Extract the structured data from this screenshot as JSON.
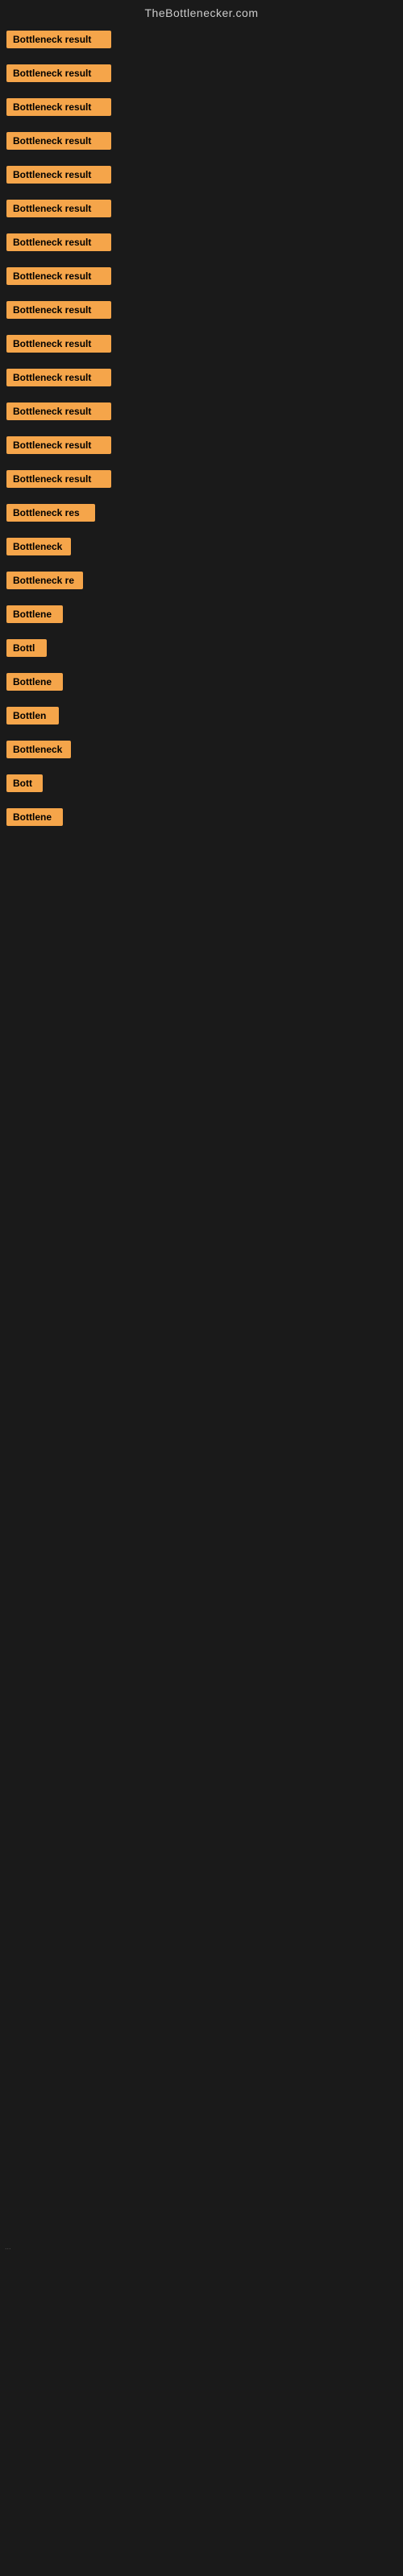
{
  "header": {
    "title": "TheBottlenecker.com"
  },
  "items": [
    {
      "label": "Bottleneck result",
      "width": 130
    },
    {
      "label": "Bottleneck result",
      "width": 130
    },
    {
      "label": "Bottleneck result",
      "width": 130
    },
    {
      "label": "Bottleneck result",
      "width": 130
    },
    {
      "label": "Bottleneck result",
      "width": 130
    },
    {
      "label": "Bottleneck result",
      "width": 130
    },
    {
      "label": "Bottleneck result",
      "width": 130
    },
    {
      "label": "Bottleneck result",
      "width": 130
    },
    {
      "label": "Bottleneck result",
      "width": 130
    },
    {
      "label": "Bottleneck result",
      "width": 130
    },
    {
      "label": "Bottleneck result",
      "width": 130
    },
    {
      "label": "Bottleneck result",
      "width": 130
    },
    {
      "label": "Bottleneck result",
      "width": 130
    },
    {
      "label": "Bottleneck result",
      "width": 130
    },
    {
      "label": "Bottleneck res",
      "width": 110
    },
    {
      "label": "Bottleneck",
      "width": 80
    },
    {
      "label": "Bottleneck re",
      "width": 95
    },
    {
      "label": "Bottlene",
      "width": 70
    },
    {
      "label": "Bottl",
      "width": 50
    },
    {
      "label": "Bottlene",
      "width": 70
    },
    {
      "label": "Bottlen",
      "width": 65
    },
    {
      "label": "Bottleneck",
      "width": 80
    },
    {
      "label": "Bott",
      "width": 45
    },
    {
      "label": "Bottlene",
      "width": 70
    }
  ],
  "footer_text": "..."
}
